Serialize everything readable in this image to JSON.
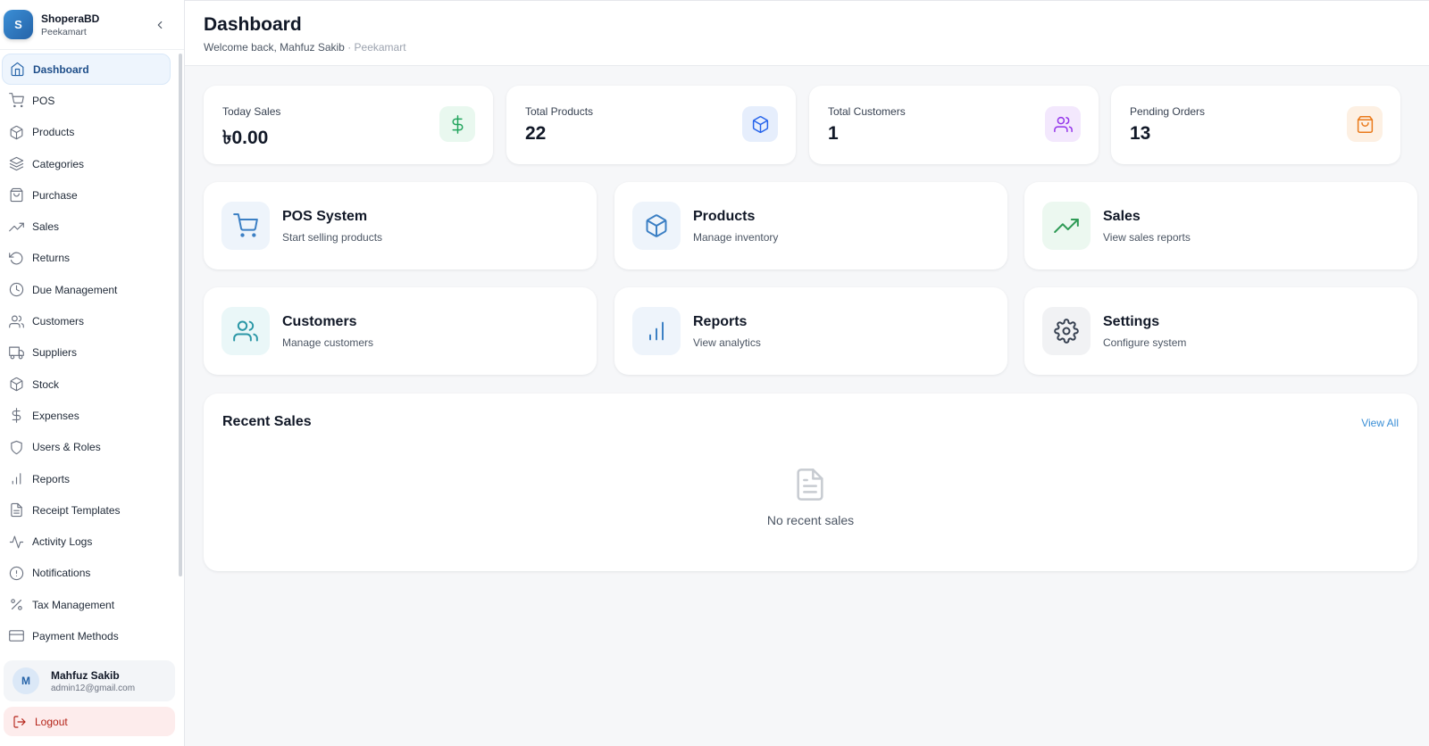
{
  "brand": {
    "logo_letter": "S",
    "name": "ShoperaBD",
    "store": "Peekamart"
  },
  "sidebar": {
    "items": [
      {
        "label": "Dashboard",
        "icon": "home-icon"
      },
      {
        "label": "POS",
        "icon": "cart-icon"
      },
      {
        "label": "Products",
        "icon": "box-icon"
      },
      {
        "label": "Categories",
        "icon": "layers-icon"
      },
      {
        "label": "Purchase",
        "icon": "bag-icon"
      },
      {
        "label": "Sales",
        "icon": "trending-up-icon"
      },
      {
        "label": "Returns",
        "icon": "rotate-icon"
      },
      {
        "label": "Due Management",
        "icon": "clock-icon"
      },
      {
        "label": "Customers",
        "icon": "users-icon"
      },
      {
        "label": "Suppliers",
        "icon": "truck-icon"
      },
      {
        "label": "Stock",
        "icon": "box-icon"
      },
      {
        "label": "Expenses",
        "icon": "dollar-icon"
      },
      {
        "label": "Users & Roles",
        "icon": "shield-icon"
      },
      {
        "label": "Reports",
        "icon": "bar-chart-icon"
      },
      {
        "label": "Receipt Templates",
        "icon": "file-icon"
      },
      {
        "label": "Activity Logs",
        "icon": "activity-icon"
      },
      {
        "label": "Notifications",
        "icon": "alert-circle-icon"
      },
      {
        "label": "Tax Management",
        "icon": "percent-icon"
      },
      {
        "label": "Payment Methods",
        "icon": "credit-card-icon"
      }
    ],
    "active_index": 0
  },
  "user": {
    "avatar_letter": "M",
    "name": "Mahfuz Sakib",
    "email": "admin12@gmail.com"
  },
  "logout_label": "Logout",
  "header": {
    "title": "Dashboard",
    "welcome": "Welcome back, Mahfuz Sakib",
    "separator": " · ",
    "store": "Peekamart"
  },
  "stats": [
    {
      "label": "Today Sales",
      "value": "৳0.00",
      "icon": "dollar-icon",
      "color": "#22a45d",
      "bg": "#e9f8ef"
    },
    {
      "label": "Total Products",
      "value": "22",
      "icon": "box-icon",
      "color": "#2563eb",
      "bg": "#e6eefc"
    },
    {
      "label": "Total Customers",
      "value": "1",
      "icon": "users-icon",
      "color": "#9333ea",
      "bg": "#f3e8fd"
    },
    {
      "label": "Pending Orders",
      "value": "13",
      "icon": "bag-icon",
      "color": "#ea7a1b",
      "bg": "#fdf0e3"
    }
  ],
  "quick_actions": [
    {
      "title": "POS System",
      "subtitle": "Start selling products",
      "icon": "cart-icon",
      "color": "#3b7fc4",
      "bg": "#eef4fb"
    },
    {
      "title": "Products",
      "subtitle": "Manage inventory",
      "icon": "box-icon",
      "color": "#3b7fc4",
      "bg": "#eef4fb"
    },
    {
      "title": "Sales",
      "subtitle": "View sales reports",
      "icon": "trending-up-icon",
      "color": "#2e9a55",
      "bg": "#ecf8f0"
    },
    {
      "title": "Customers",
      "subtitle": "Manage customers",
      "icon": "users-icon",
      "color": "#2a97a6",
      "bg": "#eaf7f8"
    },
    {
      "title": "Reports",
      "subtitle": "View analytics",
      "icon": "bar-chart-icon",
      "color": "#3b7fc4",
      "bg": "#eef4fb"
    },
    {
      "title": "Settings",
      "subtitle": "Configure system",
      "icon": "gear-icon",
      "color": "#374151",
      "bg": "#f1f2f4"
    }
  ],
  "recent_sales": {
    "title": "Recent Sales",
    "view_all": "View All",
    "empty_text": "No recent sales"
  }
}
